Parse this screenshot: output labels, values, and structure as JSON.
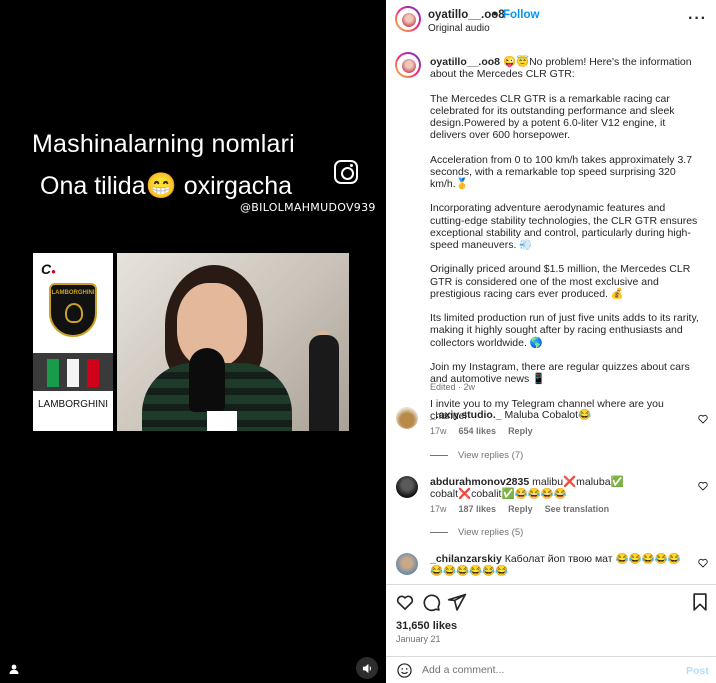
{
  "video": {
    "overlay_line1": "Mashinalarning nomlari",
    "overlay_line2": "Ona tilida😁 oxirgacha",
    "watermark": "@BILOLMAHMUDOV939",
    "brand_letter": "C",
    "shield_text": "LAMBORGHINI",
    "brand_label": "LAMBORGHINI",
    "volume_icon": "speaker-icon",
    "user_tag_icon": "person-icon"
  },
  "header": {
    "username": "oyatillo__.oo8",
    "separator": "•",
    "follow_label": "Follow",
    "audio": "Original audio",
    "more_icon": "more-horizontal-icon"
  },
  "caption": {
    "username": "oyatillo__.oo8",
    "text": "😜😇No problem! Here's the information about the Mercedes CLR GTR:\n\nThe Mercedes CLR GTR is a remarkable racing car celebrated for its outstanding performance and sleek design.Powered by a potent 6.0-liter V12 engine, it delivers over 600 horsepower.\n\nAcceleration from 0 to 100 km/h takes approximately 3.7 seconds, with a remarkable top speed surprising 320 km/h.🥇\n\nIncorporating adventure aerodynamic features and cutting-edge stability technologies, the CLR GTR ensures exceptional stability and control, particularly during high-speed maneuvers. 💨\n\nOriginally priced around $1.5 million, the Mercedes CLR GTR is considered one of the most exclusive and prestigious racing cars ever produced. 💰\n\nIts limited production run of just five units adds to its rarity, making it highly sought after by racing enthusiasts and collectors worldwide. 🌎\n\nJoin my Instagram, there are regular quizzes about cars and automotive news 📱\n\nI invite you to my Telegram channel where are you channel",
    "meta": "Edited · 2w"
  },
  "comments": [
    {
      "username": "_.axiy.studio._",
      "text": "Maluba Cobalot😂",
      "time": "17w",
      "likes": "654 likes",
      "reply_label": "Reply",
      "view_replies": "View replies (7)"
    },
    {
      "username": "abdurahmonov2835",
      "text": "malibu❌maluba✅ cobalt❌cobalit✅😂😂😂😂",
      "time": "17w",
      "likes": "187 likes",
      "reply_label": "Reply",
      "translation_label": "See translation",
      "view_replies": "View replies (5)"
    },
    {
      "username": "_chilanzarskiy",
      "text": "Каболат йоп твою мат 😂😂😂😂😂😂😂😂😂😂😂"
    }
  ],
  "actions": {
    "like_icon": "heart-icon",
    "comment_icon": "comment-icon",
    "share_icon": "send-icon",
    "save_icon": "bookmark-icon"
  },
  "likes": "31,650 likes",
  "date": "January 21",
  "composer": {
    "placeholder": "Add a comment...",
    "post_label": "Post",
    "emoji_icon": "smiley-icon"
  },
  "colors": {
    "accent": "#0095f6",
    "muted": "#737373",
    "post_disabled": "#b2dffc"
  }
}
